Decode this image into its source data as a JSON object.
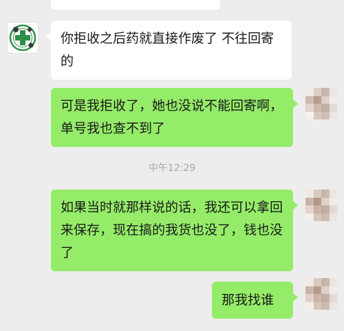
{
  "messages": [
    {
      "id": "m0",
      "side": "left",
      "text": "…"
    },
    {
      "id": "m1",
      "side": "left",
      "text": "你拒收之后药就直接作废了 不往回寄的"
    },
    {
      "id": "m2",
      "side": "right",
      "text": "可是我拒收了，她也没说不能回寄啊，单号我也查不到了"
    },
    {
      "id": "m3",
      "side": "right",
      "text": "如果当时就那样说的话，我还可以拿回来保存，现在搞的我货也没了，钱也没了"
    },
    {
      "id": "m4",
      "side": "right",
      "text": "那我找谁"
    }
  ],
  "timestamp": "中午12:29",
  "colors": {
    "background": "#ededed",
    "incoming_bubble": "#ffffff",
    "outgoing_bubble": "#95ec69",
    "timestamp_text": "#a8a8a8"
  },
  "icons": {
    "contact_avatar": "pharmacy-cross-avatar-icon",
    "user_avatar": "pixelated-user-avatar"
  }
}
